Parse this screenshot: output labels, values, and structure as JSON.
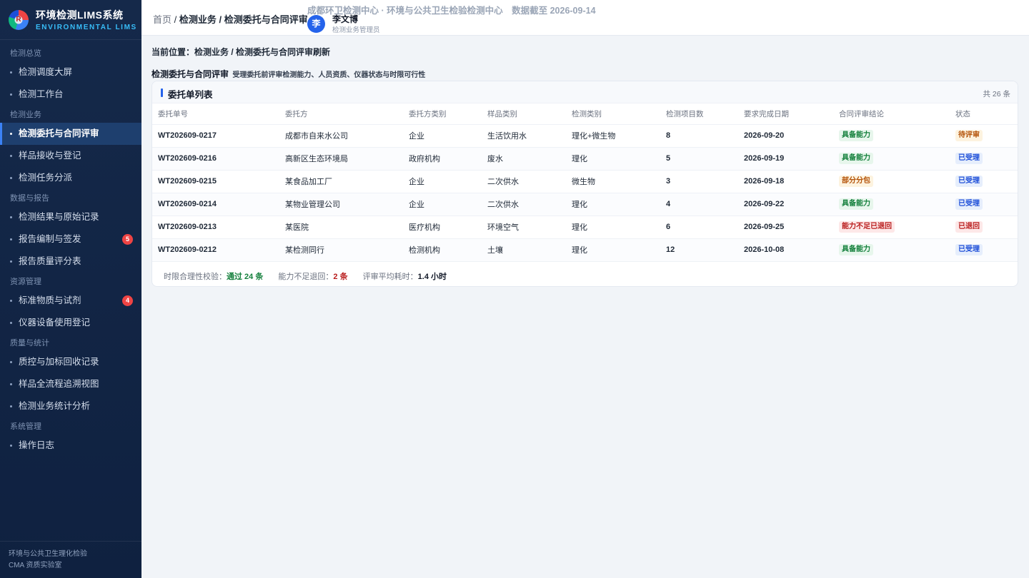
{
  "brand": {
    "logo_text": "R",
    "title": "环境检测LIMS系统",
    "subtitle": "ENVIRONMENTAL LIMS"
  },
  "sidebar": {
    "groups": [
      {
        "label": "检测总览",
        "items": [
          {
            "label": "检测调度大屏"
          },
          {
            "label": "检测工作台"
          }
        ]
      },
      {
        "label": "检测业务",
        "items": [
          {
            "label": "检测委托与合同评审",
            "active": true
          },
          {
            "label": "样品接收与登记"
          },
          {
            "label": "检测任务分派"
          }
        ]
      },
      {
        "label": "数据与报告",
        "items": [
          {
            "label": "检测结果与原始记录"
          },
          {
            "label": "报告编制与签发",
            "badge": "5"
          },
          {
            "label": "报告质量评分表"
          }
        ]
      },
      {
        "label": "资源管理",
        "items": [
          {
            "label": "标准物质与试剂",
            "badge": "4"
          },
          {
            "label": "仪器设备使用登记"
          }
        ]
      },
      {
        "label": "质量与统计",
        "items": [
          {
            "label": "质控与加标回收记录"
          },
          {
            "label": "样品全流程追溯视图"
          },
          {
            "label": "检测业务统计分析"
          }
        ]
      },
      {
        "label": "系统管理",
        "items": [
          {
            "label": "操作日志"
          }
        ]
      }
    ],
    "footer": {
      "line1": "环境与公共卫生理化检验",
      "line2": "CMA 资质实验室"
    }
  },
  "topbar": {
    "crumb_home": "首页",
    "crumb_sep": "/",
    "crumb_path": "检测业务 / 检测委托与合同评审",
    "org": "成都环卫检测中心 · 环境与公共卫生检验检测中心　数据截至 2026-09-14",
    "user": {
      "avatar": "李",
      "name": "李文博",
      "role": "检测业务管理员"
    }
  },
  "main": {
    "location": "当前位置：检测业务 / 检测委托与合同评审刷新",
    "title": "检测委托与合同评审",
    "subtitle": "受理委托前评审检测能力、人员资质、仪器状态与时限可行性",
    "card": {
      "title": "委托单列表",
      "count": "共 26 条",
      "columns": [
        "委托单号",
        "委托方",
        "委托方类别",
        "样品类别",
        "检测类别",
        "检测项目数",
        "要求完成日期",
        "合同评审结论",
        "状态"
      ],
      "rows": [
        {
          "id": "WT202609-0217",
          "client": "成都市自来水公司",
          "client_type": "企业",
          "sample": "生活饮用水",
          "category": "理化+微生物",
          "items": "8",
          "due": "2026-09-20",
          "conclusion": "具备能力",
          "conclusion_color": "green",
          "status": "待评审",
          "status_color": "amber"
        },
        {
          "id": "WT202609-0216",
          "client": "高新区生态环境局",
          "client_type": "政府机构",
          "sample": "废水",
          "category": "理化",
          "items": "5",
          "due": "2026-09-19",
          "conclusion": "具备能力",
          "conclusion_color": "green",
          "status": "已受理",
          "status_color": "blue"
        },
        {
          "id": "WT202609-0215",
          "client": "某食品加工厂",
          "client_type": "企业",
          "sample": "二次供水",
          "category": "微生物",
          "items": "3",
          "due": "2026-09-18",
          "conclusion": "部分分包",
          "conclusion_color": "amber",
          "status": "已受理",
          "status_color": "blue"
        },
        {
          "id": "WT202609-0214",
          "client": "某物业管理公司",
          "client_type": "企业",
          "sample": "二次供水",
          "category": "理化",
          "items": "4",
          "due": "2026-09-22",
          "conclusion": "具备能力",
          "conclusion_color": "green",
          "status": "已受理",
          "status_color": "blue"
        },
        {
          "id": "WT202609-0213",
          "client": "某医院",
          "client_type": "医疗机构",
          "sample": "环境空气",
          "category": "理化",
          "items": "6",
          "due": "2026-09-25",
          "conclusion": "能力不足已退回",
          "conclusion_color": "red",
          "status": "已退回",
          "status_color": "red"
        },
        {
          "id": "WT202609-0212",
          "client": "某检测同行",
          "client_type": "检测机构",
          "sample": "土壤",
          "category": "理化",
          "items": "12",
          "due": "2026-10-08",
          "conclusion": "具备能力",
          "conclusion_color": "green",
          "status": "已受理",
          "status_color": "blue"
        }
      ],
      "summary": {
        "s1_label": "时限合理性校验：",
        "s1_value": "通过 24 条",
        "s2_label": "能力不足退回：",
        "s2_value": "2 条",
        "s3_label": "评审平均耗时：",
        "s3_value": "1.4 小时"
      }
    }
  }
}
